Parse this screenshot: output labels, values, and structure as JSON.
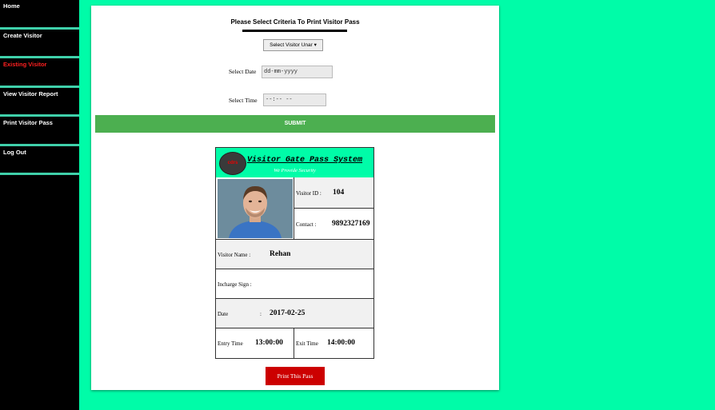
{
  "sidebar": {
    "items": [
      {
        "label": "Home"
      },
      {
        "label": "Create Visitor"
      },
      {
        "label": "Existing Visitor"
      },
      {
        "label": "View Visitor Report"
      },
      {
        "label": "Print Visitor Pass"
      },
      {
        "label": "Log Out"
      }
    ],
    "active_color": "#ff2020"
  },
  "form": {
    "title": "Please Select Criteria To Print Visitor Pass",
    "visitor_select_value": "Select Visitor Unar ▾",
    "date_label": "Select Date",
    "date_placeholder": "dd-mm-yyyy",
    "time_label": "Select Time",
    "time_placeholder": "--:-- --",
    "submit_label": "SUBMIT",
    "submit_color": "#4caf50"
  },
  "pass": {
    "logo_text": "cdrs",
    "title": "Visitor Gate Pass System",
    "tagline": "We Provide Security",
    "visitor_id_label": "Visitor ID  :",
    "visitor_id": "104",
    "contact_label": "Contact    :",
    "contact": "9892327169",
    "name_label": "Visitor Name    :",
    "name": "Rehan",
    "incharge_label": "Incharge Sign     :",
    "date_label": "Date",
    "date_colon": ":",
    "date": "2017-02-25",
    "entry_label": "Entry Time",
    "entry_time": "13:00:00",
    "exit_label": "Exit Time",
    "exit_time": "14:00:00",
    "header_color": "#00fca8"
  },
  "print_button": {
    "label": "Print This Pass",
    "color": "#cc0000"
  }
}
